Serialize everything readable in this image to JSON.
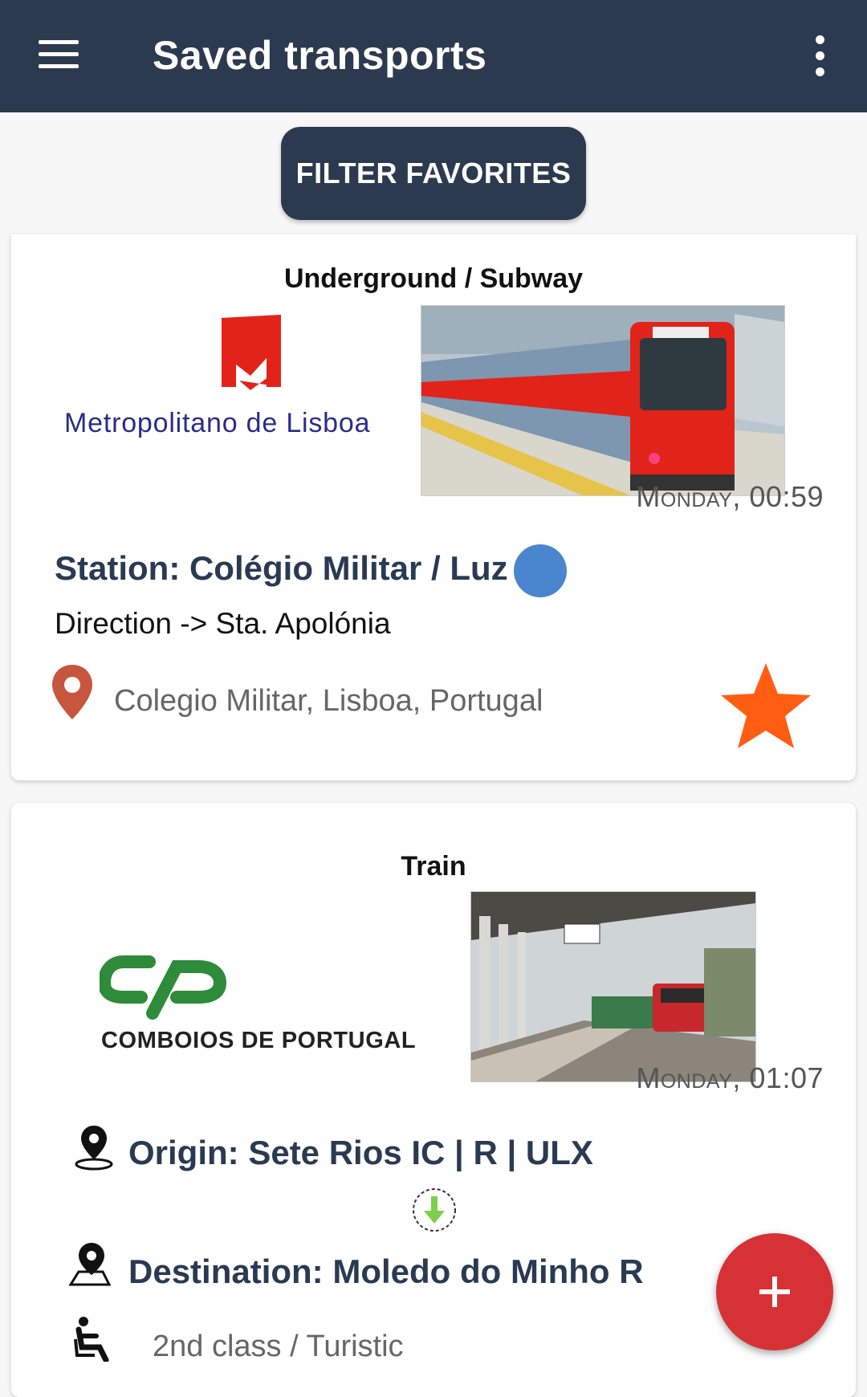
{
  "appbar": {
    "title": "Saved transports"
  },
  "filter": {
    "label": "FILTER FAVORITES"
  },
  "cards": [
    {
      "type": "Underground / Subway",
      "operator": "Metropolitano de Lisboa",
      "time_day": "Monday",
      "time_clock": "00:59",
      "station": "Station: Colégio Militar / Luz",
      "line_color": "#4a86d0",
      "direction": "Direction -> Sta. Apolónia",
      "address": "Colegio Militar, Lisboa, Portugal",
      "favorite_color": "#ff5e12"
    },
    {
      "type": "Train",
      "operator": "COMBOIOS DE PORTUGAL",
      "time_day": "Monday",
      "time_clock": "01:07",
      "origin": "Origin: Sete Rios IC | R | ULX",
      "destination": "Destination: Moledo do Minho R",
      "class": "2nd class / Turistic"
    }
  ],
  "colors": {
    "appbar": "#2c3a4f",
    "fab": "#d63236",
    "metro_red": "#e2231a",
    "cp_green": "#2e8b3a"
  }
}
